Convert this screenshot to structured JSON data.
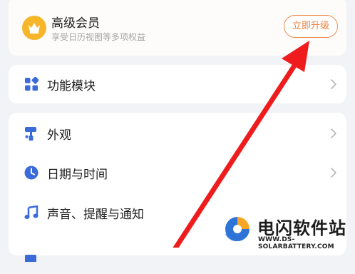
{
  "vip": {
    "title": "高级会员",
    "subtitle": "享受日历视图等多项权益",
    "upgrade_label": "立即升级",
    "icon": "crown-icon"
  },
  "module": {
    "label": "功能模块",
    "icon": "grid-icon"
  },
  "settings": {
    "items": [
      {
        "label": "外观",
        "icon": "paint-roller-icon"
      },
      {
        "label": "日期与时间",
        "icon": "clock-icon"
      },
      {
        "label": "声音、提醒与通知",
        "icon": "music-note-icon"
      }
    ]
  },
  "watermark": {
    "name": "电闪软件站",
    "url": "WWW.DS-SOLARBATTERY.COM"
  },
  "colors": {
    "accent": "#3a6bd9",
    "upgrade": "#ee7f3a",
    "crown_bg": "#f7b52a",
    "annotation_arrow": "#ee1c1c"
  }
}
